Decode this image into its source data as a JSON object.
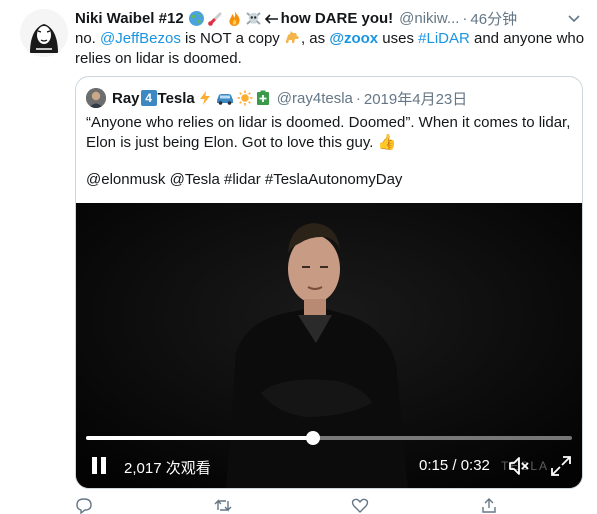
{
  "tweet": {
    "display_name": "Niki Waibel #12",
    "name_suffix": "how DARE you!",
    "handle": "@nikiw...",
    "separator": "·",
    "time": "46分钟",
    "text_before_mention1": "no. ",
    "mention1": "@JeffBezos",
    "text_after_mention1": " is NOT a copy ",
    "text_as": ", as ",
    "mention2": "@zoox",
    "text_uses": " uses ",
    "hashtag": "#LiDAR",
    "text_end": " and anyone who relies on lidar is doomed."
  },
  "quoted_tweet": {
    "display_name_pre": "Ray",
    "display_name_box": "4",
    "display_name_post": "Tesla",
    "handle": "@ray4tesla",
    "separator": "·",
    "time": "2019年4月23日",
    "text": "“Anyone who relies on lidar is doomed. Doomed”. When it comes to lidar, Elon is just being Elon. Got to love this guy. 👍",
    "tags": "@elonmusk @Tesla #lidar #TeslaAutonomyDay"
  },
  "video": {
    "views": "2,017 次观看",
    "timecode": "0:15 / 0:32",
    "progress": 0.468,
    "watermark": "TESLA"
  },
  "icons": {
    "caret": "chevron-down-icon",
    "pause": "pause-icon",
    "mute": "mute-icon",
    "fullscreen": "fullscreen-icon",
    "reply": "reply-icon",
    "retweet": "retweet-icon",
    "like": "like-icon",
    "share": "share-icon"
  },
  "colors": {
    "link": "#1b95e0",
    "secondary_text": "#657786",
    "border": "#ccd6dd"
  }
}
